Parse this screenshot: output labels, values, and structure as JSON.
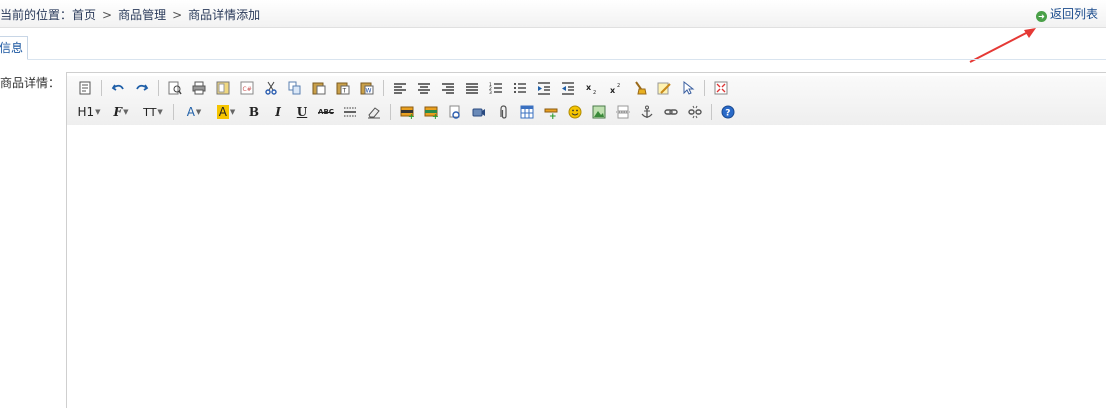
{
  "breadcrumb": {
    "prefix": "当前的位置：",
    "items": [
      "首页",
      "商品管理",
      "商品详情添加"
    ],
    "separator": ">"
  },
  "header": {
    "back_label": "返回列表",
    "back_icon": "back-arrow-icon"
  },
  "tab": {
    "label": "信息"
  },
  "form": {
    "detail_label": "商品详情："
  },
  "toolbar": {
    "row1": [
      "source-icon",
      "undo-icon",
      "redo-icon",
      "preview-icon",
      "print-icon",
      "template-icon",
      "code-icon",
      "cut-icon",
      "copy-icon",
      "paste-icon",
      "paste-text-icon",
      "paste-word-icon",
      "align-left-icon",
      "align-center-icon",
      "align-right-icon",
      "justify-icon",
      "ordered-list-icon",
      "unordered-list-icon",
      "indent-icon",
      "outdent-icon",
      "subscript-icon",
      "superscript-icon",
      "clear-format-icon",
      "select-all-icon",
      "cursor-icon",
      "fullscreen-icon"
    ],
    "row2": {
      "heading": "H1",
      "font": "F",
      "size": "TT",
      "font_color": "A",
      "bg_color": "A",
      "bold": "B",
      "italic": "I",
      "underline": "U",
      "strike": "ABC"
    },
    "accent_color": "#1a56a0",
    "highlight_color": "#f5c400"
  }
}
